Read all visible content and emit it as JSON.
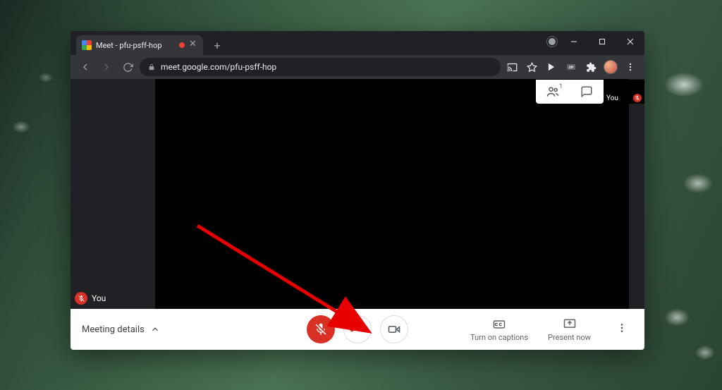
{
  "browser": {
    "tab_title": "Meet - pfu-psff-hop",
    "url": "meet.google.com/pfu-psff-hop"
  },
  "meet": {
    "participants_count": "1",
    "thumbnail_label": "You",
    "self_label": "You",
    "meeting_details_label": "Meeting details",
    "captions_label": "Turn on captions",
    "present_label": "Present now"
  },
  "colors": {
    "red": "#d93025",
    "grey": "#5f6368"
  }
}
